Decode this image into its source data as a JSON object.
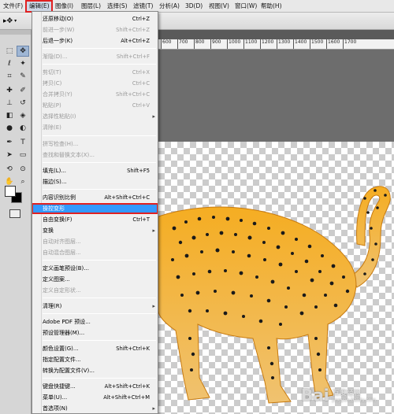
{
  "menubar": {
    "items": [
      "文件(F)",
      "编辑(E)",
      "图像(I)",
      "图层(L)",
      "选择(S)",
      "滤镜(T)",
      "分析(A)",
      "3D(D)",
      "视图(V)",
      "窗口(W)",
      "帮助(H)"
    ],
    "active_index": 1
  },
  "ruler": {
    "ticks": [
      "600",
      "700",
      "800",
      "900",
      "1000",
      "1100",
      "1200",
      "1300",
      "1400",
      "1500",
      "1600",
      "1700"
    ]
  },
  "edit_menu": {
    "items": [
      {
        "label": "还原移动(O)",
        "shortcut": "Ctrl+Z",
        "disabled": false
      },
      {
        "label": "前进一步(W)",
        "shortcut": "Shift+Ctrl+Z",
        "disabled": true
      },
      {
        "label": "后退一步(K)",
        "shortcut": "Alt+Ctrl+Z",
        "disabled": false
      },
      {
        "label": "渐隐(D)...",
        "shortcut": "Shift+Ctrl+F",
        "disabled": true
      },
      {
        "label": "剪切(T)",
        "shortcut": "Ctrl+X",
        "disabled": true
      },
      {
        "label": "拷贝(C)",
        "shortcut": "Ctrl+C",
        "disabled": true
      },
      {
        "label": "合并拷贝(Y)",
        "shortcut": "Shift+Ctrl+C",
        "disabled": true
      },
      {
        "label": "粘贴(P)",
        "shortcut": "Ctrl+V",
        "disabled": true
      },
      {
        "label": "选择性粘贴(I)",
        "shortcut": "",
        "disabled": true,
        "submenu": true
      },
      {
        "label": "清除(E)",
        "shortcut": "",
        "disabled": true
      },
      {
        "label": "拼写检查(H)...",
        "shortcut": "",
        "disabled": true
      },
      {
        "label": "查找和替换文本(X)...",
        "shortcut": "",
        "disabled": true
      },
      {
        "label": "填充(L)...",
        "shortcut": "Shift+F5",
        "disabled": false
      },
      {
        "label": "描边(S)...",
        "shortcut": "",
        "disabled": false
      },
      {
        "label": "内容识别比例",
        "shortcut": "Alt+Shift+Ctrl+C",
        "disabled": false
      },
      {
        "label": "操控变形",
        "shortcut": "",
        "disabled": false,
        "highlighted": true
      },
      {
        "label": "自由变换(F)",
        "shortcut": "Ctrl+T",
        "disabled": false
      },
      {
        "label": "变换",
        "shortcut": "",
        "disabled": false,
        "submenu": true
      },
      {
        "label": "自动对齐图层...",
        "shortcut": "",
        "disabled": true
      },
      {
        "label": "自动混合图层...",
        "shortcut": "",
        "disabled": true
      },
      {
        "label": "定义画笔预设(B)...",
        "shortcut": "",
        "disabled": false
      },
      {
        "label": "定义图案...",
        "shortcut": "",
        "disabled": false
      },
      {
        "label": "定义自定形状...",
        "shortcut": "",
        "disabled": true
      },
      {
        "label": "清理(R)",
        "shortcut": "",
        "disabled": false,
        "submenu": true
      },
      {
        "label": "Adobe PDF 预设...",
        "shortcut": "",
        "disabled": false
      },
      {
        "label": "预设管理器(M)...",
        "shortcut": "",
        "disabled": false
      },
      {
        "label": "颜色设置(G)...",
        "shortcut": "Shift+Ctrl+K",
        "disabled": false
      },
      {
        "label": "指定配置文件...",
        "shortcut": "",
        "disabled": false
      },
      {
        "label": "转换为配置文件(V)...",
        "shortcut": "",
        "disabled": false
      },
      {
        "label": "键盘快捷键...",
        "shortcut": "Alt+Shift+Ctrl+K",
        "disabled": false
      },
      {
        "label": "菜单(U)...",
        "shortcut": "Alt+Shift+Ctrl+M",
        "disabled": false
      },
      {
        "label": "首选项(N)",
        "shortcut": "",
        "disabled": false,
        "submenu": true
      }
    ]
  },
  "watermark": {
    "logo": "Bai",
    "text": "百度经验",
    "sub": "jingyan.baidu.com"
  },
  "colors": {
    "highlight": "#3399ff",
    "annotation": "#e02020",
    "cheetah": "#f2a41c"
  }
}
